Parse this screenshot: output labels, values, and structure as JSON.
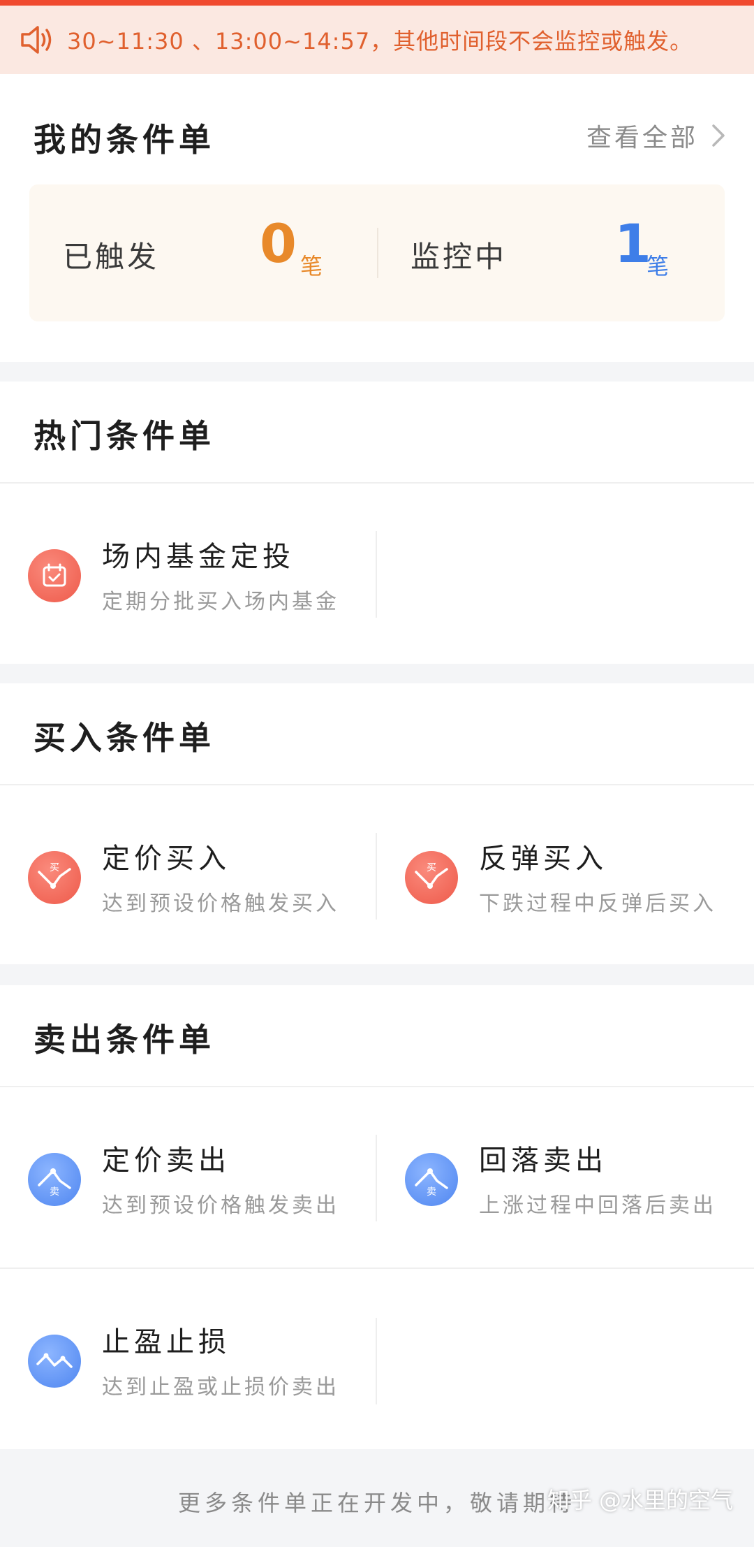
{
  "notice": {
    "text": "30~11:30 、13:00~14:57，其他时间段不会监控或触发。",
    "color": "#e0602e"
  },
  "my_orders": {
    "title": "我的条件单",
    "view_all": "查看全部",
    "triggered": {
      "label": "已触发",
      "count": "0",
      "unit": "笔",
      "color": "#e8892a"
    },
    "monitoring": {
      "label": "监控中",
      "count": "1",
      "unit": "笔",
      "color": "#3e7ee8"
    }
  },
  "hot": {
    "title": "热门条件单",
    "items": [
      {
        "title": "场内基金定投",
        "sub": "定期分批买入场内基金",
        "icon": "calendar-icon"
      }
    ]
  },
  "buy": {
    "title": "买入条件单",
    "items": [
      {
        "title": "定价买入",
        "sub": "达到预设价格触发买入",
        "icon": "price-buy-icon",
        "badge": "买"
      },
      {
        "title": "反弹买入",
        "sub": "下跌过程中反弹后买入",
        "icon": "rebound-buy-icon",
        "badge": "买"
      }
    ]
  },
  "sell": {
    "title": "卖出条件单",
    "items": [
      {
        "title": "定价卖出",
        "sub": "达到预设价格触发卖出",
        "icon": "price-sell-icon",
        "badge": "卖"
      },
      {
        "title": "回落卖出",
        "sub": "上涨过程中回落后卖出",
        "icon": "pullback-sell-icon",
        "badge": "卖"
      },
      {
        "title": "止盈止损",
        "sub": "达到止盈或止损价卖出",
        "icon": "stop-profit-loss-icon"
      }
    ]
  },
  "footer": {
    "text": "更多条件单正在开发中，敬请期待"
  },
  "watermark": "知乎 @水里的空气"
}
